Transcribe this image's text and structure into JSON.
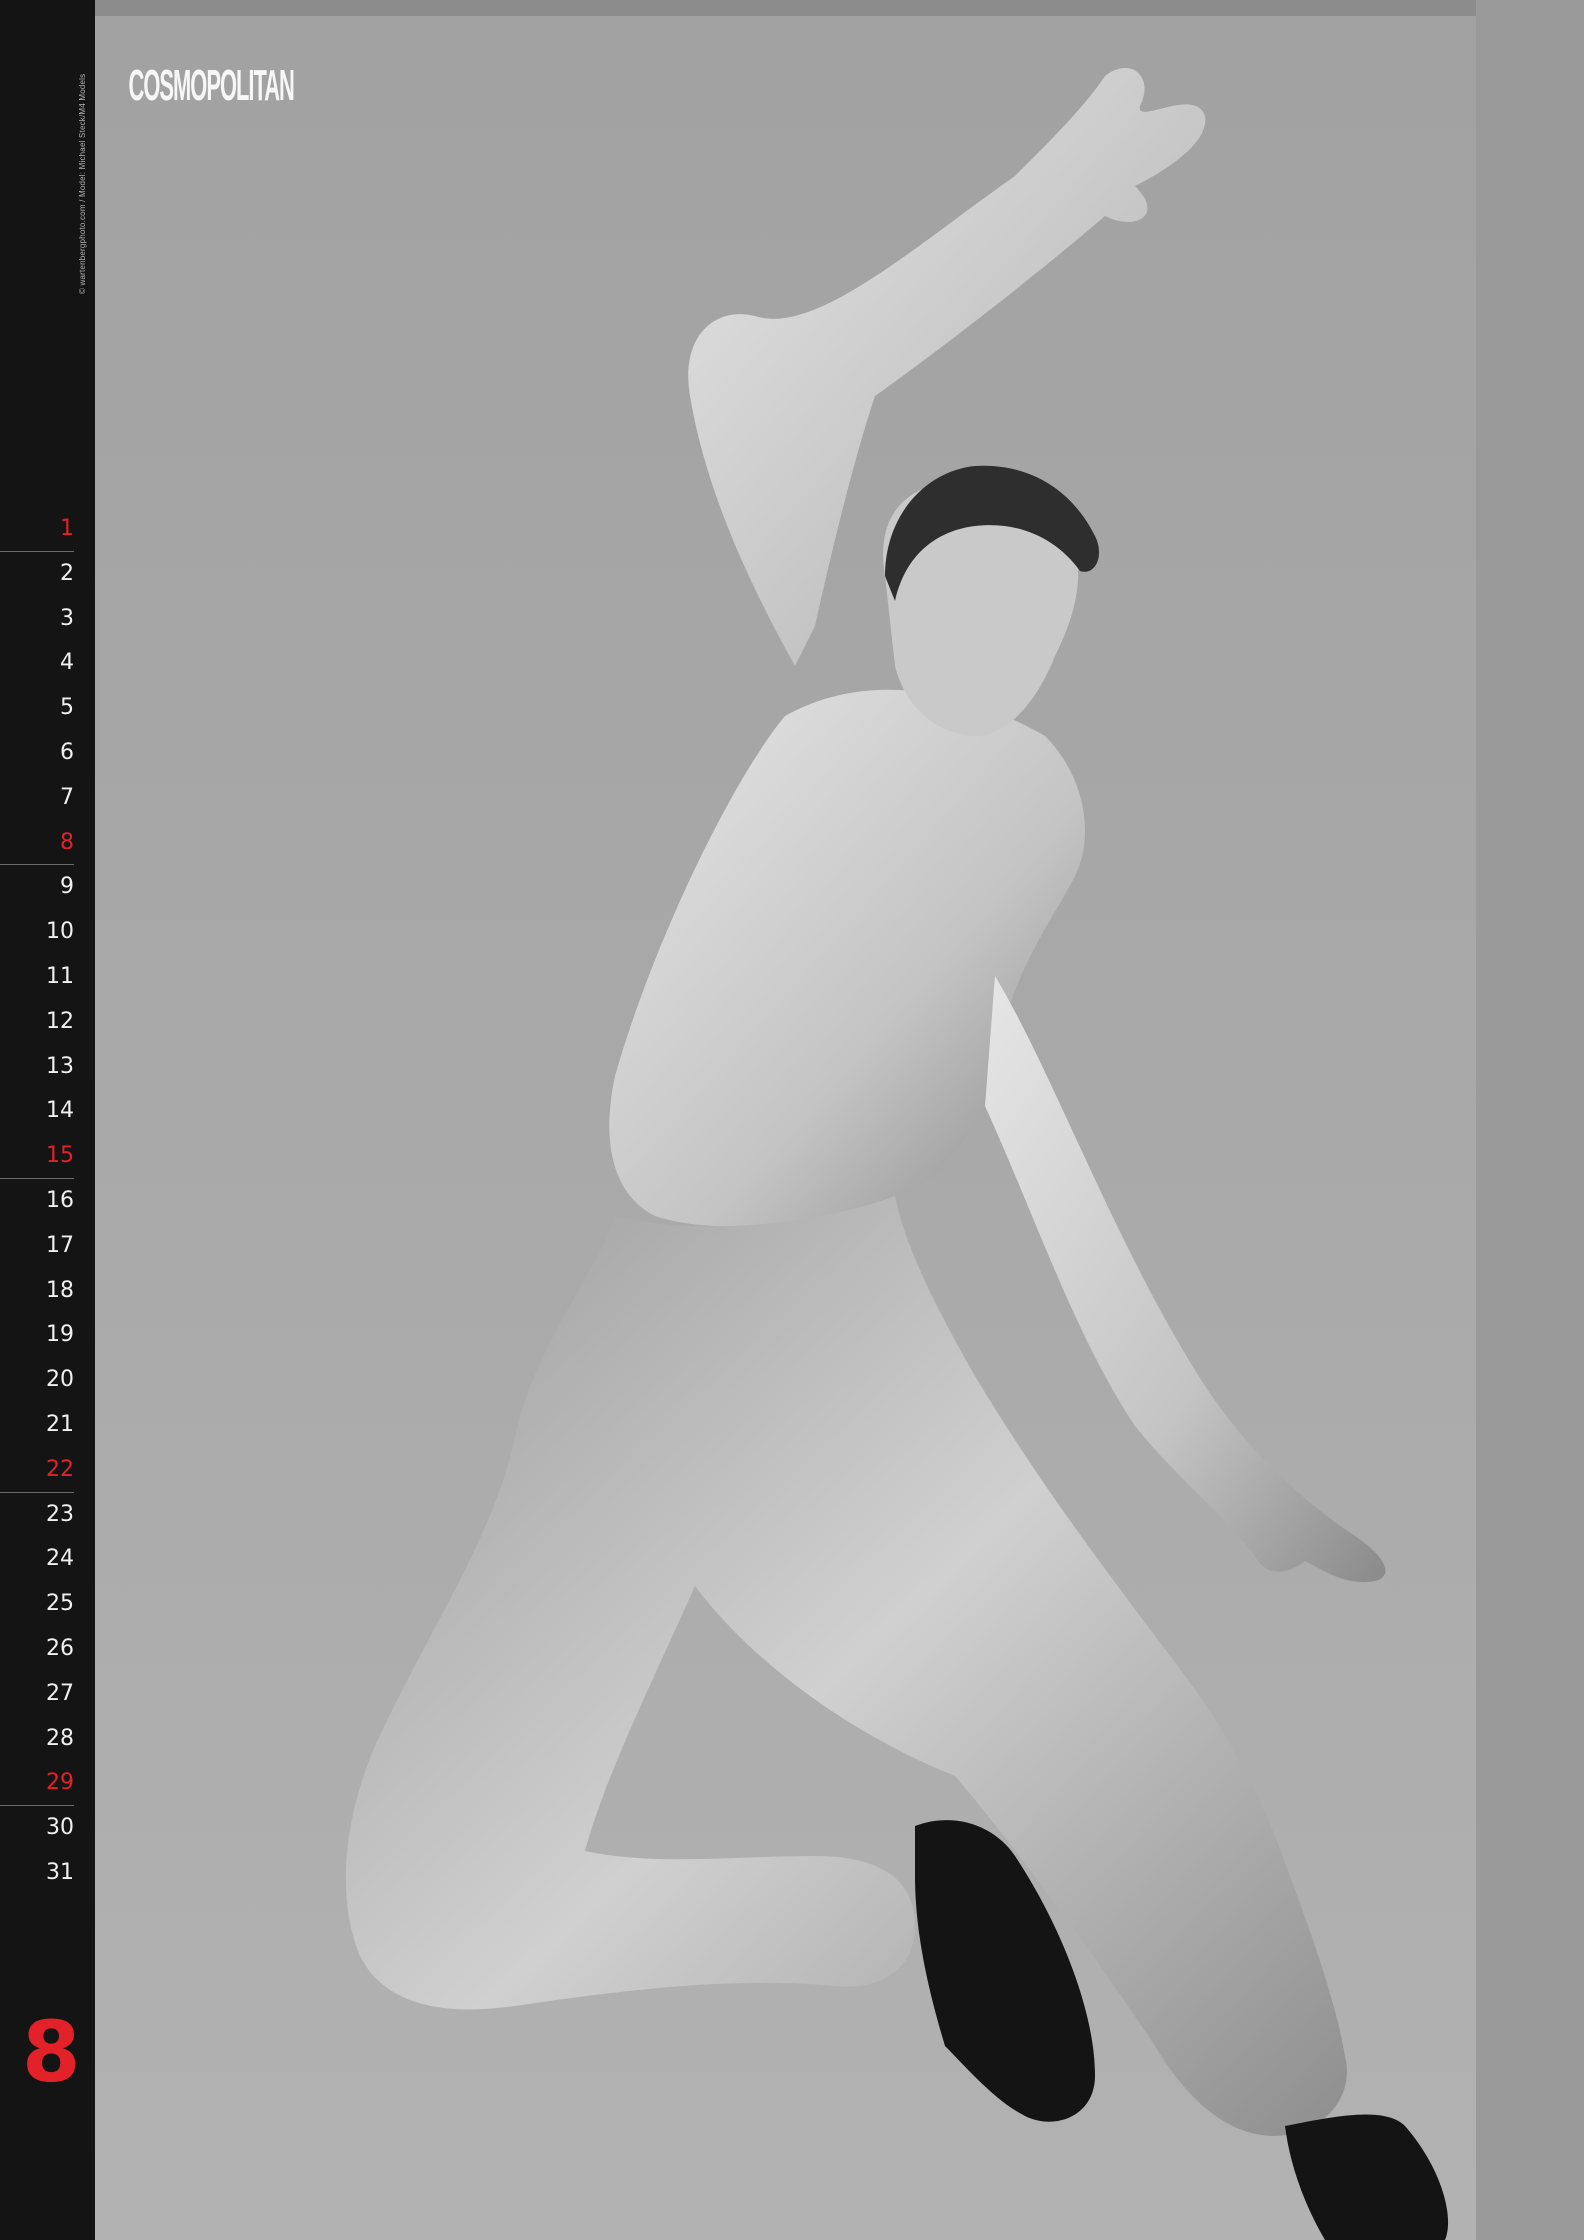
{
  "calendar": {
    "month_number": "8",
    "days": [
      {
        "label": "1",
        "red": true
      },
      {
        "label": "2",
        "red": false
      },
      {
        "label": "3",
        "red": false
      },
      {
        "label": "4",
        "red": false
      },
      {
        "label": "5",
        "red": false
      },
      {
        "label": "6",
        "red": false
      },
      {
        "label": "7",
        "red": false
      },
      {
        "label": "8",
        "red": true
      },
      {
        "label": "9",
        "red": false
      },
      {
        "label": "10",
        "red": false
      },
      {
        "label": "11",
        "red": false
      },
      {
        "label": "12",
        "red": false
      },
      {
        "label": "13",
        "red": false
      },
      {
        "label": "14",
        "red": false
      },
      {
        "label": "15",
        "red": true
      },
      {
        "label": "16",
        "red": false
      },
      {
        "label": "17",
        "red": false
      },
      {
        "label": "18",
        "red": false
      },
      {
        "label": "19",
        "red": false
      },
      {
        "label": "20",
        "red": false
      },
      {
        "label": "21",
        "red": false
      },
      {
        "label": "22",
        "red": true
      },
      {
        "label": "23",
        "red": false
      },
      {
        "label": "24",
        "red": false
      },
      {
        "label": "25",
        "red": false
      },
      {
        "label": "26",
        "red": false
      },
      {
        "label": "27",
        "red": false
      },
      {
        "label": "28",
        "red": false
      },
      {
        "label": "29",
        "red": true
      },
      {
        "label": "30",
        "red": false
      },
      {
        "label": "31",
        "red": false
      }
    ]
  },
  "masthead": "COSMOPOLITAN",
  "credit": "© wartenbergphoto.com / Model: Michael Steck/M4 Models",
  "colors": {
    "sidebar": "#141414",
    "accent_red": "#e32128",
    "day_text": "#f0f0f0"
  }
}
